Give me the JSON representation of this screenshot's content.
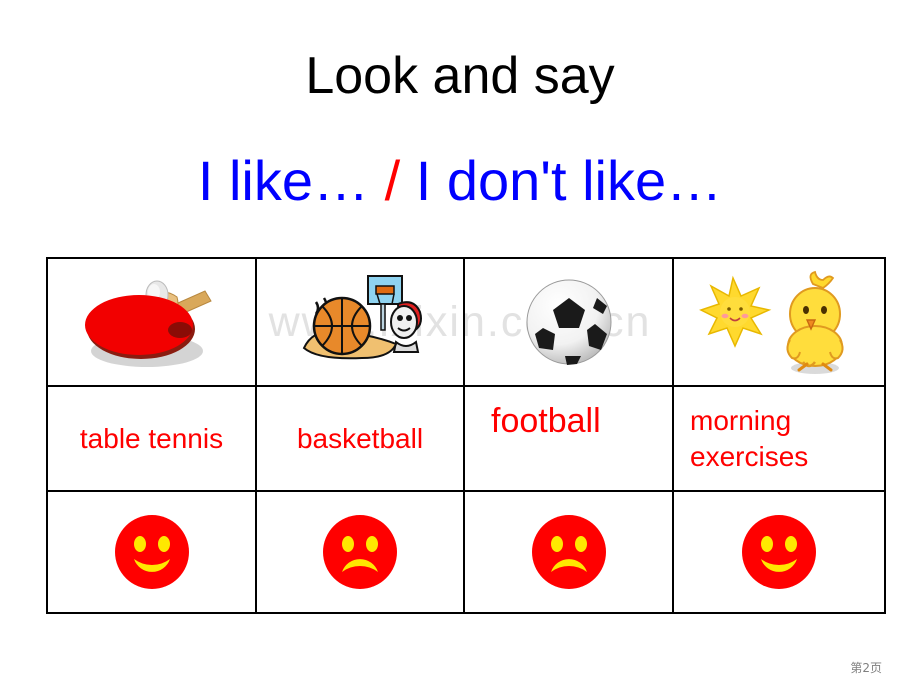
{
  "slide": {
    "title": "Look and say",
    "subtitle_part1": "I like…",
    "subtitle_slash": "/",
    "subtitle_part2": "I don't like…",
    "watermark": "www.ixixin.com.cn",
    "footer": "第2页"
  },
  "colors": {
    "title": "#000000",
    "subtitle": "#0000FF",
    "slash": "#FF0000",
    "label": "#FF0000",
    "face_fill": "#FF0000",
    "face_feature": "#FFE800",
    "border": "#000000",
    "watermark": "#E2E2E2",
    "footer": "#808080"
  },
  "table": {
    "columns": 4,
    "rows": 3,
    "items": [
      {
        "picture": "table-tennis-paddle-clipart",
        "label": "table tennis",
        "face": "happy-face",
        "face_label": "happy"
      },
      {
        "picture": "basketball-hoop-player-clipart",
        "label": "basketball",
        "face": "sad-face",
        "face_label": "sad"
      },
      {
        "picture": "soccer-ball-clipart",
        "label": "football",
        "face": "sad-face",
        "face_label": "sad"
      },
      {
        "picture": "sun-and-chick-clipart",
        "label": "morning exercises",
        "face": "happy-face",
        "face_label": "happy"
      }
    ]
  }
}
